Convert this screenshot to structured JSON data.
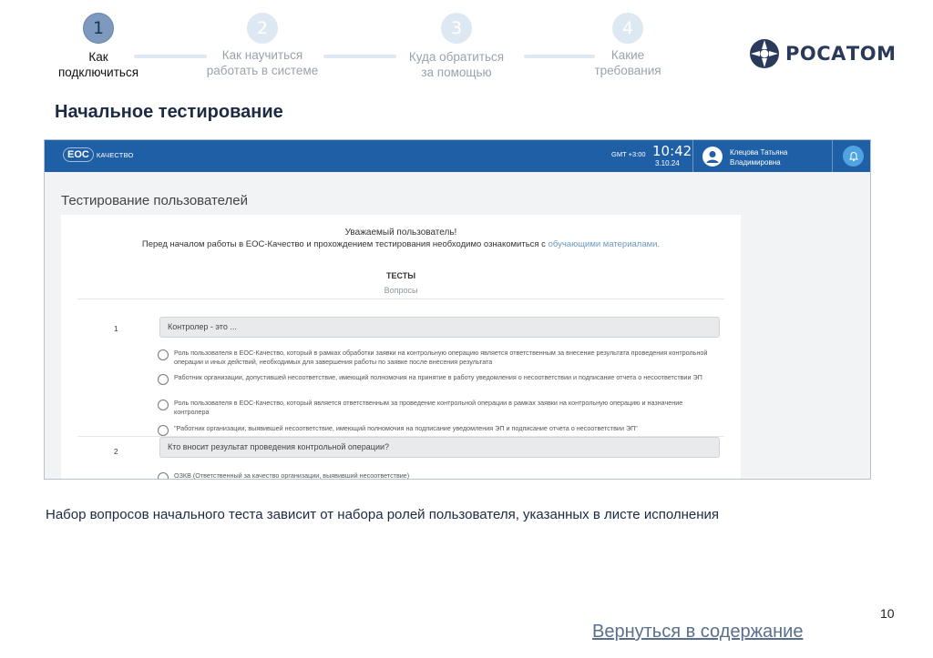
{
  "stepper": {
    "steps": [
      {
        "number": "1",
        "label_line1": "Как",
        "label_line2": "подключиться"
      },
      {
        "number": "2",
        "label_line1": "Как научиться",
        "label_line2": "работать в системе"
      },
      {
        "number": "3",
        "label_line1": "Куда обратиться",
        "label_line2": "за помощью"
      },
      {
        "number": "4",
        "label_line1": "Какие",
        "label_line2": "требования"
      }
    ],
    "active_step": 1
  },
  "brand": {
    "logo_text": "РОСАТОМ",
    "color": "#2a3a5a"
  },
  "title": "Начальное тестирование",
  "app": {
    "header_color": "#1e5fa6",
    "logo_abbr": "ЕОС",
    "logo_sub": "КАЧЕСТВО",
    "timezone": "GMT +3:00",
    "time": "10:42",
    "date": "3.10.24",
    "user_line1": "Клецова Татьяна",
    "user_line2": "Владимировна",
    "page_title": "Тестирование пользователей",
    "greeting": "Уважаемый пользователь!",
    "intro_text": "Перед началом работы в ЕОС-Качество и прохождением тестирования необходимо ознакомиться с ",
    "intro_link": "обучающими материалами.",
    "tests_heading": "ТЕСТЫ",
    "questions_heading": "Вопросы",
    "questions": [
      {
        "number": "1",
        "text": "Контролер - это ...",
        "options": [
          "Роль пользователя в ЕОС-Качество, который в рамках обработки заявки на контрольную операцию является ответственным за внесение результата проведения контрольной операции и иных действий, необходимых для завершения работы по заявке после внесения результата",
          "Работник организации, допустившей несоответствие, имеющий полномочия на принятие в работу уведомления о несоответствии и подписание отчета о несоответствии ЭП",
          "Роль пользователя в ЕОС-Качество, который является ответственным за проведение контрольной операции в рамках заявки на контрольную операцию и назначение контролера",
          "\"Работник организации, выявившей несоответствие, имеющий полномочия на подписание уведомления ЭП и подписание отчета о несоответствии ЭП\""
        ]
      },
      {
        "number": "2",
        "text": "Кто вносит результат проведения контрольной операции?",
        "options": [
          "ОЗКВ (Ответственный за качество организации, выявивший несоответствие)"
        ]
      }
    ]
  },
  "caption": "Набор вопросов начального теста зависит от набора ролей пользователя, указанных в листе исполнения",
  "page_number": "10",
  "back_link": "Вернуться в содержание"
}
